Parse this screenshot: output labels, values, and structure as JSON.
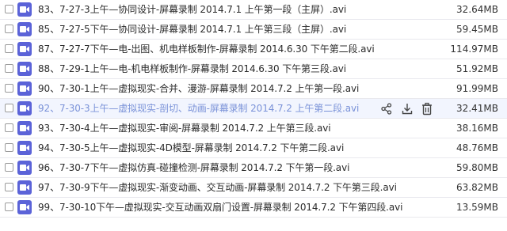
{
  "files": [
    {
      "name": "83、7-27-3上午—协同设计-屏幕录制 2014.7.1 上午第一段（主屏）.avi",
      "size": "32.64MB"
    },
    {
      "name": "85、7-27-5下午—协同设计-屏幕录制 2014.7.1 上午第三段（主屏）.avi",
      "size": "59.45MB"
    },
    {
      "name": "87、7-27-7下午—电-出图、机电样板制作-屏幕录制 2014.6.30 下午第二段.avi",
      "size": "114.97MB"
    },
    {
      "name": "88、7-29-1上午—电-机电样板制作-屏幕录制 2014.6.30 下午第三段.avi",
      "size": "51.92MB"
    },
    {
      "name": "90、7-30-1上午—虚拟现实-合并、漫游-屏幕录制 2014.7.2 上午第一段.avi",
      "size": "91.99MB"
    },
    {
      "name": "92、7-30-3上午—虚拟现实-剖切、动画-屏幕录制 2014.7.2 上午第二段.avi",
      "size": "32.41MB"
    },
    {
      "name": "93、7-30-4上午—虚拟现实-审阅-屏幕录制 2014.7.2 上午第三段.avi",
      "size": "38.16MB"
    },
    {
      "name": "94、7-30-5上午—虚拟现实-4D模型-屏幕录制 2014.7.2 下午第二段.avi",
      "size": "48.76MB"
    },
    {
      "name": "96、7-30-7下午—虚拟仿真-碰撞检测-屏幕录制 2014.7.2 下午第一段.avi",
      "size": "59.80MB"
    },
    {
      "name": "97、7-30-9下午—虚拟现实-渐变动画、交互动画-屏幕录制 2014.7.2 下午第三段.avi",
      "size": "63.82MB"
    },
    {
      "name": "99、7-30-10下午—虚拟现实-交互动画双扇门设置-屏幕录制 2014.7.2 下午第四段.avi",
      "size": "13.59MB"
    }
  ],
  "hover_index": 5,
  "actions": [
    "share-icon",
    "download-icon",
    "delete-icon"
  ],
  "colors": {
    "icon": "#5b63d8",
    "hover_text": "#7a92d8",
    "hover_bg": "#f2f5fe"
  }
}
